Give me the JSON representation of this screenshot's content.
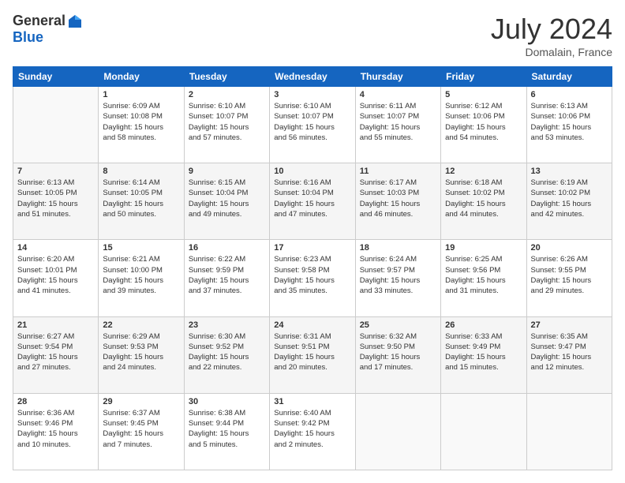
{
  "logo": {
    "general": "General",
    "blue": "Blue"
  },
  "title": "July 2024",
  "location": "Domalain, France",
  "days_header": [
    "Sunday",
    "Monday",
    "Tuesday",
    "Wednesday",
    "Thursday",
    "Friday",
    "Saturday"
  ],
  "weeks": [
    [
      {
        "num": "",
        "info": ""
      },
      {
        "num": "1",
        "info": "Sunrise: 6:09 AM\nSunset: 10:08 PM\nDaylight: 15 hours\nand 58 minutes."
      },
      {
        "num": "2",
        "info": "Sunrise: 6:10 AM\nSunset: 10:07 PM\nDaylight: 15 hours\nand 57 minutes."
      },
      {
        "num": "3",
        "info": "Sunrise: 6:10 AM\nSunset: 10:07 PM\nDaylight: 15 hours\nand 56 minutes."
      },
      {
        "num": "4",
        "info": "Sunrise: 6:11 AM\nSunset: 10:07 PM\nDaylight: 15 hours\nand 55 minutes."
      },
      {
        "num": "5",
        "info": "Sunrise: 6:12 AM\nSunset: 10:06 PM\nDaylight: 15 hours\nand 54 minutes."
      },
      {
        "num": "6",
        "info": "Sunrise: 6:13 AM\nSunset: 10:06 PM\nDaylight: 15 hours\nand 53 minutes."
      }
    ],
    [
      {
        "num": "7",
        "info": "Sunrise: 6:13 AM\nSunset: 10:05 PM\nDaylight: 15 hours\nand 51 minutes."
      },
      {
        "num": "8",
        "info": "Sunrise: 6:14 AM\nSunset: 10:05 PM\nDaylight: 15 hours\nand 50 minutes."
      },
      {
        "num": "9",
        "info": "Sunrise: 6:15 AM\nSunset: 10:04 PM\nDaylight: 15 hours\nand 49 minutes."
      },
      {
        "num": "10",
        "info": "Sunrise: 6:16 AM\nSunset: 10:04 PM\nDaylight: 15 hours\nand 47 minutes."
      },
      {
        "num": "11",
        "info": "Sunrise: 6:17 AM\nSunset: 10:03 PM\nDaylight: 15 hours\nand 46 minutes."
      },
      {
        "num": "12",
        "info": "Sunrise: 6:18 AM\nSunset: 10:02 PM\nDaylight: 15 hours\nand 44 minutes."
      },
      {
        "num": "13",
        "info": "Sunrise: 6:19 AM\nSunset: 10:02 PM\nDaylight: 15 hours\nand 42 minutes."
      }
    ],
    [
      {
        "num": "14",
        "info": "Sunrise: 6:20 AM\nSunset: 10:01 PM\nDaylight: 15 hours\nand 41 minutes."
      },
      {
        "num": "15",
        "info": "Sunrise: 6:21 AM\nSunset: 10:00 PM\nDaylight: 15 hours\nand 39 minutes."
      },
      {
        "num": "16",
        "info": "Sunrise: 6:22 AM\nSunset: 9:59 PM\nDaylight: 15 hours\nand 37 minutes."
      },
      {
        "num": "17",
        "info": "Sunrise: 6:23 AM\nSunset: 9:58 PM\nDaylight: 15 hours\nand 35 minutes."
      },
      {
        "num": "18",
        "info": "Sunrise: 6:24 AM\nSunset: 9:57 PM\nDaylight: 15 hours\nand 33 minutes."
      },
      {
        "num": "19",
        "info": "Sunrise: 6:25 AM\nSunset: 9:56 PM\nDaylight: 15 hours\nand 31 minutes."
      },
      {
        "num": "20",
        "info": "Sunrise: 6:26 AM\nSunset: 9:55 PM\nDaylight: 15 hours\nand 29 minutes."
      }
    ],
    [
      {
        "num": "21",
        "info": "Sunrise: 6:27 AM\nSunset: 9:54 PM\nDaylight: 15 hours\nand 27 minutes."
      },
      {
        "num": "22",
        "info": "Sunrise: 6:29 AM\nSunset: 9:53 PM\nDaylight: 15 hours\nand 24 minutes."
      },
      {
        "num": "23",
        "info": "Sunrise: 6:30 AM\nSunset: 9:52 PM\nDaylight: 15 hours\nand 22 minutes."
      },
      {
        "num": "24",
        "info": "Sunrise: 6:31 AM\nSunset: 9:51 PM\nDaylight: 15 hours\nand 20 minutes."
      },
      {
        "num": "25",
        "info": "Sunrise: 6:32 AM\nSunset: 9:50 PM\nDaylight: 15 hours\nand 17 minutes."
      },
      {
        "num": "26",
        "info": "Sunrise: 6:33 AM\nSunset: 9:49 PM\nDaylight: 15 hours\nand 15 minutes."
      },
      {
        "num": "27",
        "info": "Sunrise: 6:35 AM\nSunset: 9:47 PM\nDaylight: 15 hours\nand 12 minutes."
      }
    ],
    [
      {
        "num": "28",
        "info": "Sunrise: 6:36 AM\nSunset: 9:46 PM\nDaylight: 15 hours\nand 10 minutes."
      },
      {
        "num": "29",
        "info": "Sunrise: 6:37 AM\nSunset: 9:45 PM\nDaylight: 15 hours\nand 7 minutes."
      },
      {
        "num": "30",
        "info": "Sunrise: 6:38 AM\nSunset: 9:44 PM\nDaylight: 15 hours\nand 5 minutes."
      },
      {
        "num": "31",
        "info": "Sunrise: 6:40 AM\nSunset: 9:42 PM\nDaylight: 15 hours\nand 2 minutes."
      },
      {
        "num": "",
        "info": ""
      },
      {
        "num": "",
        "info": ""
      },
      {
        "num": "",
        "info": ""
      }
    ]
  ]
}
